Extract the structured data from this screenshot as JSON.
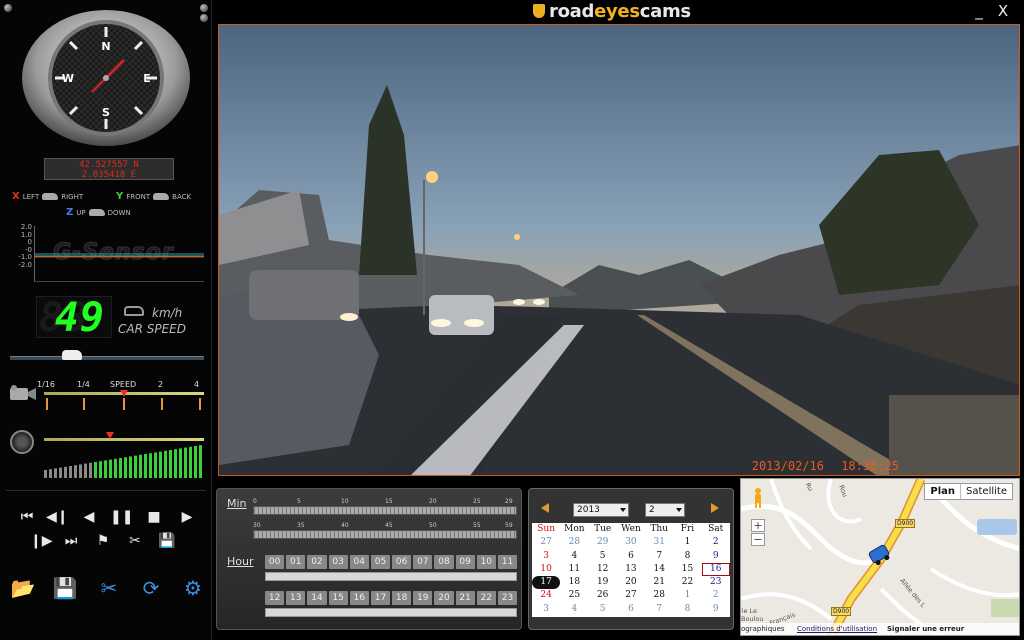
{
  "app": {
    "logo_road": "road",
    "logo_eyes": "eyes",
    "logo_cams": "cams",
    "minimize_label": "_",
    "close_label": "X"
  },
  "compass": {
    "n": "N",
    "e": "E",
    "s": "S",
    "w": "W"
  },
  "gps": {
    "lat": "42.527557 N",
    "lon": "2.835418 E"
  },
  "axes": {
    "x": "X",
    "left": "LEFT",
    "right": "RIGHT",
    "y": "Y",
    "front": "FRONT",
    "back": "BACK",
    "z": "Z",
    "up": "UP",
    "down": "DOWN"
  },
  "gsensor": {
    "label": "G-Sensor",
    "scale": [
      "2.0",
      "1.0",
      "0",
      "-0",
      "-1.0",
      "-2.0"
    ]
  },
  "speed": {
    "value": "49",
    "ghost": "88",
    "unit": "km/h",
    "label": "CAR SPEED"
  },
  "video_progress": 0.3,
  "playback_speed": {
    "labels": [
      "1/16",
      "1/4",
      "SPEED",
      "2",
      "4"
    ],
    "current": "1"
  },
  "volume_level": 0.42,
  "controls": {
    "row1": [
      "⏮",
      "◀❙",
      "◀",
      "❚❚",
      "■",
      "▶"
    ],
    "row2": [
      "❙▶",
      "⏭",
      "⚑",
      "✂︎",
      "💾"
    ],
    "tools": [
      "📂",
      "💾",
      "✂",
      "⟳",
      "⚙"
    ]
  },
  "video": {
    "date": "2013/02/16",
    "time": "18:38:25"
  },
  "time_panel": {
    "min_label": "Min",
    "hour_label": "Hour",
    "min_row1": [
      "0",
      "5",
      "10",
      "15",
      "20",
      "25",
      "29"
    ],
    "min_row2": [
      "30",
      "35",
      "40",
      "45",
      "50",
      "55",
      "59"
    ],
    "hours_row1": [
      "00",
      "01",
      "02",
      "03",
      "04",
      "05",
      "06",
      "07",
      "08",
      "09",
      "10",
      "11"
    ],
    "hours_row2": [
      "12",
      "13",
      "14",
      "15",
      "16",
      "17",
      "18",
      "19",
      "20",
      "21",
      "22",
      "23"
    ]
  },
  "calendar": {
    "year": "2013",
    "month": "2",
    "weekdays": [
      "Sun",
      "Mon",
      "Tue",
      "Wen",
      "Thu",
      "Fri",
      "Sat"
    ],
    "weeks": [
      [
        "27",
        "28",
        "29",
        "30",
        "31",
        "1",
        "2"
      ],
      [
        "3",
        "4",
        "5",
        "6",
        "7",
        "8",
        "9"
      ],
      [
        "10",
        "11",
        "12",
        "13",
        "14",
        "15",
        "16"
      ],
      [
        "17",
        "18",
        "19",
        "20",
        "21",
        "22",
        "23"
      ],
      [
        "24",
        "25",
        "26",
        "27",
        "28",
        "1",
        "2"
      ],
      [
        "3",
        "4",
        "5",
        "6",
        "7",
        "8",
        "9"
      ]
    ],
    "selected": "16",
    "today": "17"
  },
  "map": {
    "plan": "Plan",
    "satellite": "Satellite",
    "zoom_in": "+",
    "zoom_out": "−",
    "footer_left": "ographiques",
    "footer_conditions": "Conditions d'utilisation",
    "footer_report": "Signaler une erreur cartographique",
    "road_d900_a": "D900",
    "road_d900_b": "D900",
    "label_rue": "Ru",
    "label_allee": "Allée des L",
    "label_place": "rie Le",
    "label_place2": "Boulou",
    "label_francais": "Français",
    "label_route": "Rou"
  },
  "colors": {
    "accent": "#c85a1e",
    "speed_green": "#22ff22",
    "gps_red": "#e0281e",
    "tool_blue": "#3a8fe0",
    "route_yellow": "#f4e04a"
  }
}
